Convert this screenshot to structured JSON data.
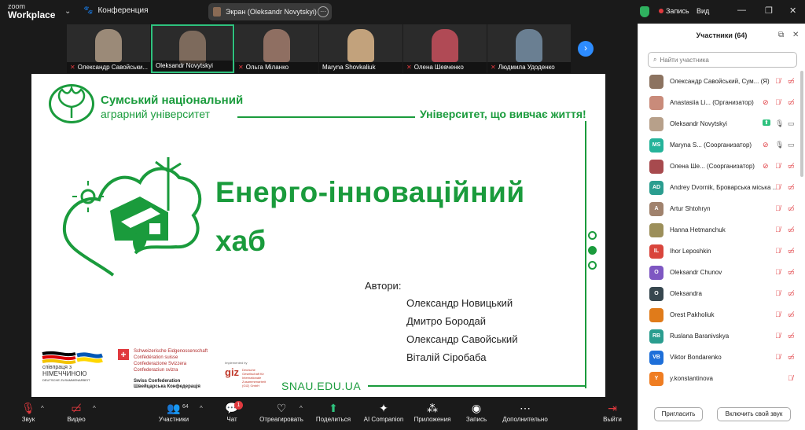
{
  "app": {
    "brand_top": "zoom",
    "brand_bottom": "Workplace",
    "meeting_label": "Конференция"
  },
  "screen_share": {
    "label": "Экран (Oleksandr Novytskyi)"
  },
  "top_right": {
    "record_label": "Запись",
    "view_label": "Вид"
  },
  "thumbnails": [
    {
      "name": "Олександр Савойськи...",
      "muted": true,
      "active": false,
      "color": "#9b8a78"
    },
    {
      "name": "Oleksandr Novytskyi",
      "muted": false,
      "active": true,
      "color": "#7d6a5c"
    },
    {
      "name": "Ольга Міланко",
      "muted": true,
      "active": false,
      "color": "#8f6f62"
    },
    {
      "name": "Maryna Shovkaliuk",
      "muted": false,
      "active": false,
      "color": "#c2a27c"
    },
    {
      "name": "Олена Шевченко",
      "muted": true,
      "active": false,
      "color": "#b04a55"
    },
    {
      "name": "Людмила Удоденко",
      "muted": true,
      "active": false,
      "color": "#6a7f92"
    }
  ],
  "slide": {
    "university_line1": "Сумський національний",
    "university_line2": "аграрний університет",
    "motto": "Університет, що вивчає життя!",
    "title_line1": "Енерго-інноваційний",
    "title_line2": "хаб",
    "authors_label": "Автори:",
    "authors": [
      "Олександр Новицький",
      "Дмитро Бородай",
      "Олександр Савойський",
      "Віталій Сіробаба"
    ],
    "website": "SNAU.EDU.UA",
    "partner_de_line1": "співпраця з",
    "partner_de_line2": "НІМЕЧЧИНОЮ",
    "partner_de_line3": "DEUTSCHE ZUSAMMENARBEIT",
    "swiss_lines": [
      "Schweizerische Eidgenossenschaft",
      "Confédération suisse",
      "Confederazione Svizzera",
      "Confederaziun svizra"
    ],
    "swiss_en_line1": "Swiss Confederation",
    "swiss_en_line2": "Швейцарська Конфедерація",
    "giz_implemented": "Implemented by",
    "giz": "giz",
    "giz_sub": "Deutsche Gesellschaft für Internationale Zusammenarbeit (GIZ) GmbH"
  },
  "panel": {
    "title": "Участники (64)",
    "search_placeholder": "Найти участника",
    "participants": [
      {
        "initials": "",
        "name": "Олександр Савойський, Сум... (Я)",
        "color": "#8c7360",
        "icons": [
          "mic-off",
          "video-off"
        ],
        "status": "r"
      },
      {
        "initials": "",
        "name": "Anastasiia Li... (Организатор)",
        "color": "#c98b7a",
        "icons": [
          "sound-off",
          "mic-off",
          "video-off"
        ],
        "status": "r"
      },
      {
        "initials": "",
        "name": "Oleksandr Novytskyi",
        "color": "#b7a08a",
        "icons": [
          "share",
          "mic",
          "video"
        ],
        "status": "g"
      },
      {
        "initials": "MS",
        "name": "Maryna S... (Соорганизатор)",
        "color": "#25b39a",
        "icons": [
          "sound-off",
          "mic",
          "video"
        ],
        "status": "g"
      },
      {
        "initials": "",
        "name": "Олена Ше... (Соорганизатор)",
        "color": "#a74a4e",
        "icons": [
          "sound-off",
          "mic-off",
          "video-off"
        ],
        "status": "r"
      },
      {
        "initials": "AD",
        "name": "Andrey Dvornik, Броварська міська ...",
        "color": "#2a9d8f",
        "icons": [
          "mic-off",
          "video-off"
        ],
        "status": "r"
      },
      {
        "initials": "A",
        "name": "Artur Shtohryn",
        "color": "#a0826d",
        "icons": [
          "mic-off",
          "video-off"
        ],
        "status": "r"
      },
      {
        "initials": "",
        "name": "Hanna Hetmanchuk",
        "color": "#9c8f5a",
        "icons": [
          "mic-off",
          "video-off"
        ],
        "status": "r"
      },
      {
        "initials": "IL",
        "name": "Ihor Leposhkin",
        "color": "#d9453c",
        "icons": [
          "mic-off",
          "video-off"
        ],
        "status": "r"
      },
      {
        "initials": "O",
        "name": "Oleksandr Chunov",
        "color": "#7e57c2",
        "icons": [
          "mic-off",
          "video-off"
        ],
        "status": "r"
      },
      {
        "initials": "O",
        "name": "Oleksandra",
        "color": "#37474f",
        "icons": [
          "mic-off",
          "video-off"
        ],
        "status": "r"
      },
      {
        "initials": "",
        "name": "Orest Pakholiuk",
        "color": "#e07b1a",
        "icons": [
          "mic-off",
          "video-off"
        ],
        "status": "r"
      },
      {
        "initials": "RB",
        "name": "Ruslana Baranivskya",
        "color": "#2a9d8f",
        "icons": [
          "mic-off",
          "video-off"
        ],
        "status": "r"
      },
      {
        "initials": "VB",
        "name": "Viktor Bondarenko",
        "color": "#1e6fd9",
        "icons": [
          "mic-off",
          "video-off"
        ],
        "status": "r"
      },
      {
        "initials": "Y",
        "name": "y.konstantinova",
        "color": "#ef7d22",
        "icons": [
          "mic-off"
        ],
        "status": "r"
      }
    ],
    "invite_label": "Пригласить",
    "unmute_label": "Включить свой звук"
  },
  "toolbar": {
    "audio": "Звук",
    "video": "Видео",
    "participants": "Участники",
    "participants_count": "64",
    "chat": "Чат",
    "chat_badge": "1",
    "react": "Отреагировать",
    "share": "Поделиться",
    "ai": "AI Companion",
    "apps": "Приложения",
    "record": "Запись",
    "more": "Дополнительно",
    "leave": "Выйти"
  }
}
